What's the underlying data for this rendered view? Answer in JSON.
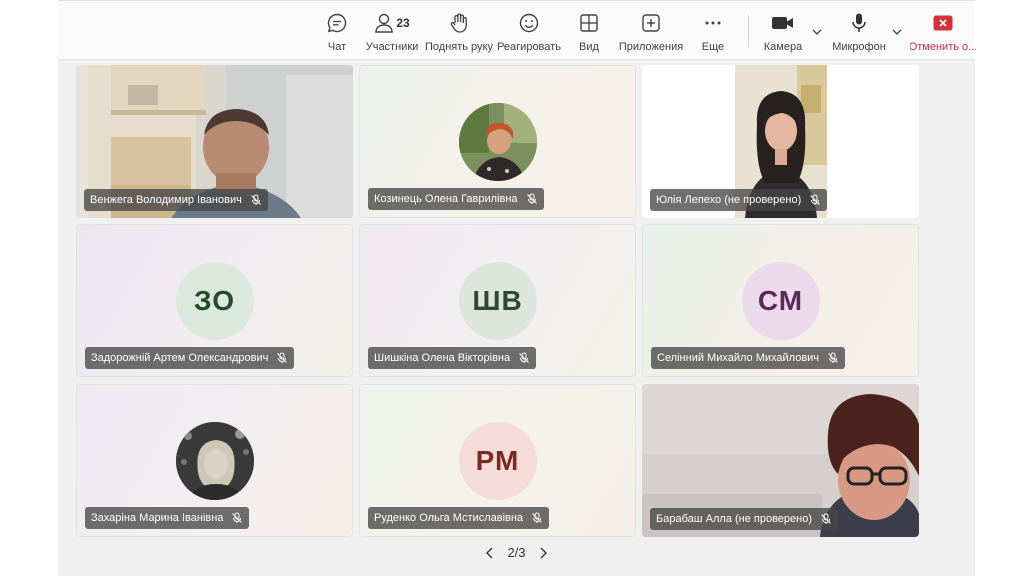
{
  "toolbar": {
    "chat": "Чат",
    "participants": "Участники",
    "participants_count": "23",
    "raise_hand": "Поднять руку",
    "react": "Реагировать",
    "view": "Вид",
    "apps": "Приложения",
    "more": "Еще",
    "camera": "Камера",
    "mic": "Микрофон",
    "leave": "Отменить о...",
    "leave_color": "#c4314b"
  },
  "tiles": [
    {
      "name": "Венжега Володимир Іванович",
      "type": "video"
    },
    {
      "name": "Козинець Олена Гаврилівна",
      "type": "photo-avatar"
    },
    {
      "name": "Юлія Лепехо (не проверено)",
      "type": "video"
    },
    {
      "name": "Задорожній Артем Олександрович",
      "type": "initials",
      "initials": "ЗО",
      "avatar_bg": "#dce8dd",
      "avatar_fg": "#254b2b"
    },
    {
      "name": "Шишкіна Олена Вікторівна",
      "type": "initials",
      "initials": "ШВ",
      "avatar_bg": "#dde6dc",
      "avatar_fg": "#2e4a2e"
    },
    {
      "name": "Селінний Михайло Михайлович",
      "type": "initials",
      "initials": "СМ",
      "avatar_bg": "#ecd9ec",
      "avatar_fg": "#5b2a5b"
    },
    {
      "name": "Захаріна Марина Іванівна",
      "type": "photo-avatar"
    },
    {
      "name": "Руденко Ольга Мстиславівна",
      "type": "initials",
      "initials": "РМ",
      "avatar_bg": "#f6dcd8",
      "avatar_fg": "#7a2a22"
    },
    {
      "name": "Барабаш Алла (не проверено)",
      "type": "video"
    }
  ],
  "pager": {
    "label": "2/3"
  }
}
